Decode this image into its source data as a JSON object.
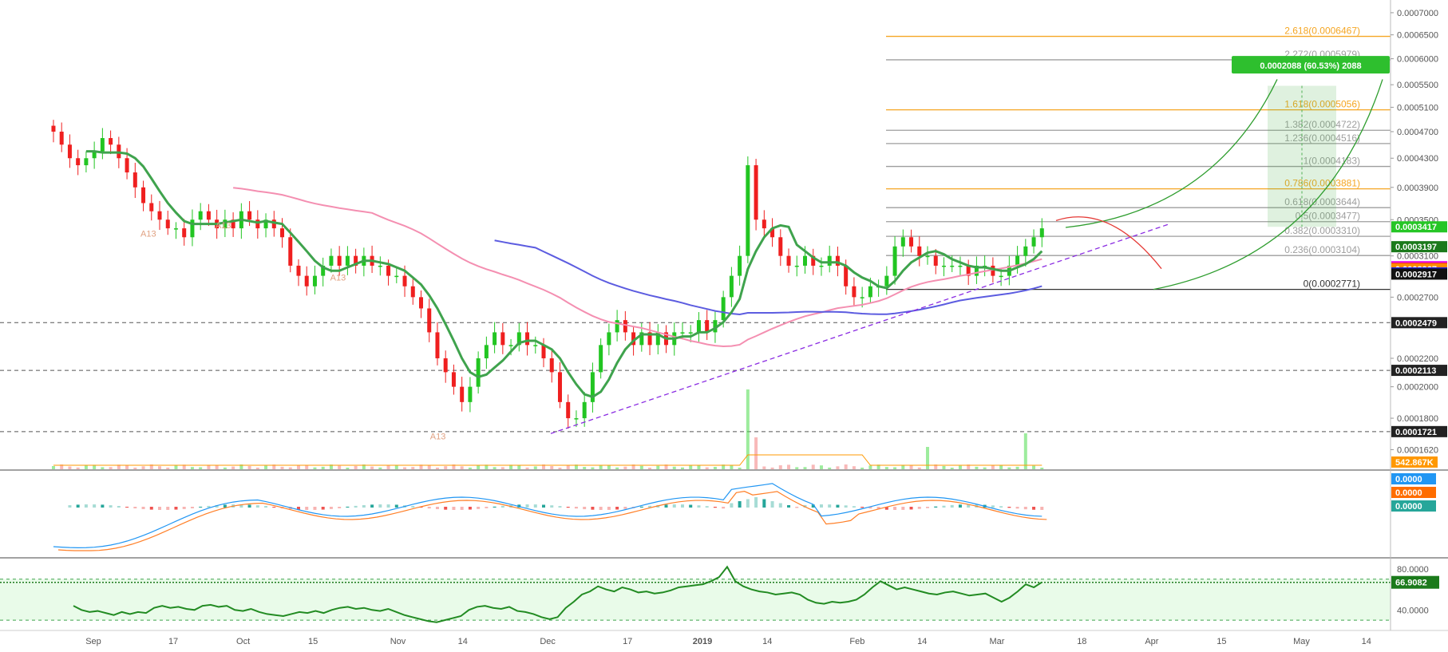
{
  "chart_data": [
    {
      "type": "candlestick",
      "panel": "price",
      "x_labels": [
        "Sep",
        "17",
        "Oct",
        "15",
        "Nov",
        "14",
        "Dec",
        "17",
        "2019",
        "14",
        "Feb",
        "14",
        "Mar",
        "18",
        "Apr",
        "15",
        "May",
        "14"
      ],
      "x_label_positions_day": [
        0,
        16,
        30,
        44,
        61,
        74,
        91,
        107,
        122,
        135,
        153,
        166,
        181,
        198,
        212,
        226,
        242,
        255
      ],
      "x_range_days": [
        -17,
        267
      ],
      "y_range": [
        0.000155,
        0.000715
      ],
      "y_ticks": [
        "0.0007000",
        "0.0006500",
        "0.0006000",
        "0.0005500",
        "0.0005100",
        "0.0004700",
        "0.0004300",
        "0.0003900",
        "0.0003500",
        "0.0003100",
        "0.0002700",
        "0.0002200",
        "0.0002000",
        "0.0001800",
        "0.0001620"
      ],
      "y_tick_values": [
        0.0007,
        0.00065,
        0.0006,
        0.00055,
        0.00051,
        0.00047,
        0.00043,
        0.00039,
        0.00035,
        0.00031,
        0.00027,
        0.00022,
        0.0002,
        0.00018,
        0.000162
      ],
      "fib_levels": [
        {
          "label": "2.618(0.0006467)",
          "value": 0.0006467,
          "color": "#f5a623"
        },
        {
          "label": "2.272(0.0005979)",
          "value": 0.0005979,
          "color": "#9e9e9e"
        },
        {
          "label": "1.618(0.0005056)",
          "value": 0.0005056,
          "color": "#f5a623"
        },
        {
          "label": "1.382(0.0004722)",
          "value": 0.0004722,
          "color": "#9e9e9e"
        },
        {
          "label": "1.236(0.0004516)",
          "value": 0.0004516,
          "color": "#9e9e9e"
        },
        {
          "label": "1(0.0004183)",
          "value": 0.0004183,
          "color": "#9e9e9e"
        },
        {
          "label": "0.786(0.0003881)",
          "value": 0.0003881,
          "color": "#f5a623"
        },
        {
          "label": "0.618(0.0003644)",
          "value": 0.0003644,
          "color": "#9e9e9e"
        },
        {
          "label": "0.5(0.0003477)",
          "value": 0.0003477,
          "color": "#9e9e9e"
        },
        {
          "label": "0.382(0.0003310)",
          "value": 0.000331,
          "color": "#9e9e9e"
        },
        {
          "label": "0.236(0.0003104)",
          "value": 0.0003104,
          "color": "#9e9e9e"
        },
        {
          "label": "0(0.0002771)",
          "value": 0.0002771,
          "color": "#333333"
        }
      ],
      "price_tags": [
        {
          "label": "0.0003417",
          "value": 0.0003417,
          "color": "#26c626"
        },
        {
          "label": "0.0003197",
          "value": 0.0003197,
          "color": "#1b7a1b"
        },
        {
          "label": "0.0002991",
          "value": 0.0002991,
          "color": "#e91ee9"
        },
        {
          "label": "0.0002974",
          "value": 0.0002974,
          "color": "#f02020"
        },
        {
          "label": "0.0002967",
          "value": 0.0002967,
          "color": "#ff8a00"
        },
        {
          "label": "0.0002928",
          "value": 0.0002928,
          "color": "#2020e0"
        },
        {
          "label": "0.0002917",
          "value": 0.0002917,
          "color": "#111111"
        },
        {
          "label": "0.0002479",
          "value": 0.0002479,
          "color": "#222222"
        },
        {
          "label": "0.0002113",
          "value": 0.0002113,
          "color": "#222222"
        },
        {
          "label": "0.0001721",
          "value": 0.0001721,
          "color": "#222222"
        }
      ],
      "horizontal_dashed_lines": [
        0.0002479,
        0.0002113,
        0.0001721
      ],
      "measure_label": "0.0002088 (60.53%) 2088",
      "annotations": [
        "A13",
        "A13",
        "A13",
        "A13"
      ],
      "volume_label": "542.867K",
      "close_series": [
        0.00047,
        0.00045,
        0.00043,
        0.00042,
        0.00043,
        0.00044,
        0.00046,
        0.00045,
        0.00043,
        0.00041,
        0.00039,
        0.00037,
        0.00036,
        0.00035,
        0.00034,
        0.00034,
        0.00033,
        0.00035,
        0.00036,
        0.00035,
        0.00034,
        0.00035,
        0.00034,
        0.00036,
        0.00035,
        0.00034,
        0.00035,
        0.00034,
        0.00033,
        0.0003,
        0.00029,
        0.00028,
        0.00029,
        0.0003,
        0.00031,
        0.0003,
        0.00031,
        0.0003,
        0.00031,
        0.0003,
        0.0003,
        0.00029,
        0.00029,
        0.00028,
        0.00027,
        0.00026,
        0.00024,
        0.00022,
        0.00021,
        0.0002,
        0.00019,
        0.0002,
        0.00022,
        0.00023,
        0.00024,
        0.00023,
        0.00023,
        0.00024,
        0.00023,
        0.00023,
        0.00022,
        0.00021,
        0.00019,
        0.00018,
        0.00018,
        0.00019,
        0.00021,
        0.00023,
        0.00024,
        0.00025,
        0.00024,
        0.00023,
        0.00024,
        0.00023,
        0.00024,
        0.00023,
        0.00024,
        0.00024,
        0.00024,
        0.00025,
        0.00024,
        0.00025,
        0.00027,
        0.00029,
        0.00031,
        0.00042,
        0.00035,
        0.00034,
        0.00033,
        0.00031,
        0.0003,
        0.0003,
        0.00031,
        0.0003,
        0.0003,
        0.00031,
        0.0003,
        0.00028,
        0.00027,
        0.00027,
        0.00028,
        0.00028,
        0.00029,
        0.00032,
        0.00033,
        0.00032,
        0.00031,
        0.00031,
        0.0003,
        0.0003,
        0.0003,
        0.0003,
        0.00029,
        0.0003,
        0.0003,
        0.00029,
        0.00029,
        0.0003,
        0.00031,
        0.00032,
        0.00033,
        0.00034
      ]
    },
    {
      "type": "line",
      "panel": "macd",
      "tags": [
        {
          "label": "0.0000",
          "color": "#2196f3"
        },
        {
          "label": "0.0000",
          "color": "#ff6d00"
        },
        {
          "label": "0.0000",
          "color": "#26a69a"
        }
      ]
    },
    {
      "type": "line",
      "panel": "rsi",
      "y_range": [
        20,
        90
      ],
      "y_ticks": [
        "80.0000",
        "40.0000"
      ],
      "y_tick_values": [
        80,
        40
      ],
      "value_label": "66.9082",
      "value": 66.9082,
      "series": [
        {
          "values": [
            44,
            40,
            38,
            39,
            37,
            35,
            38,
            36,
            38,
            37,
            42,
            44,
            42,
            43,
            41,
            40,
            44,
            45,
            43,
            44,
            40,
            39,
            41,
            38,
            36,
            35,
            34,
            36,
            38,
            37,
            39,
            37,
            40,
            42,
            43,
            41,
            42,
            40,
            39,
            41,
            38,
            35,
            33,
            31,
            29,
            28,
            30,
            32,
            34,
            40,
            43,
            44,
            42,
            41,
            43,
            39,
            38,
            36,
            33,
            31,
            33,
            42,
            48,
            55,
            58,
            63,
            60,
            58,
            62,
            60,
            57,
            58,
            56,
            57,
            59,
            62,
            63,
            64,
            65,
            68,
            72,
            82,
            68,
            63,
            60,
            58,
            57,
            55,
            56,
            57,
            55,
            50,
            47,
            46,
            48,
            47,
            48,
            50,
            55,
            62,
            68,
            64,
            60,
            62,
            60,
            58,
            56,
            55,
            57,
            58,
            56,
            54,
            55,
            56,
            52,
            48,
            52,
            58,
            65,
            62,
            67
          ]
        }
      ]
    }
  ]
}
